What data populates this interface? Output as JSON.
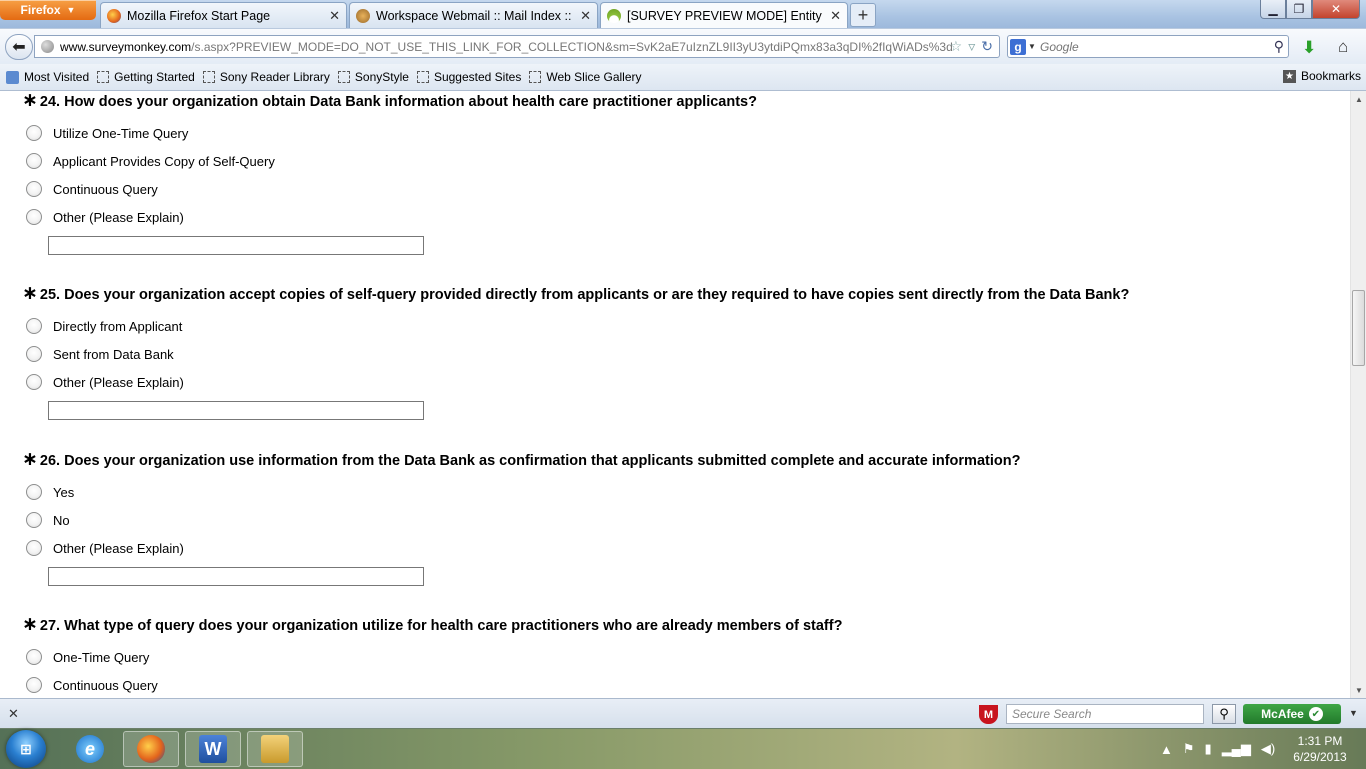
{
  "browser": {
    "menu_label": "Firefox",
    "tabs": [
      {
        "label": "Mozilla Firefox Start Page",
        "active": false
      },
      {
        "label": "Workspace Webmail :: Mail Index :: H...",
        "active": false
      },
      {
        "label": "[SURVEY PREVIEW MODE] Entity Surv...",
        "active": true
      }
    ],
    "url_domain": "www.surveymonkey.com",
    "url_path": "/s.aspx?PREVIEW_MODE=DO_NOT_USE_THIS_LINK_FOR_COLLECTION&sm=SvK2aE7uIznZL9II3yU3ytdiPQmx83a3qDI%2fIqWiADs%3d",
    "search_placeholder": "Google",
    "bookmarks": [
      "Most Visited",
      "Getting Started",
      "Sony Reader Library",
      "SonyStyle",
      "Suggested Sites",
      "Web Slice Gallery"
    ],
    "bookmarks_menu_label": "Bookmarks"
  },
  "survey": {
    "questions": [
      {
        "title": "24. How does your organization obtain Data Bank information about health care practitioner applicants?",
        "options": [
          "Utilize One-Time Query",
          "Applicant Provides Copy of Self-Query",
          "Continuous Query",
          "Other (Please Explain)"
        ],
        "has_other_input": true
      },
      {
        "title": "25. Does your organization accept copies of self-query provided directly from applicants or are they required to have copies sent directly from the Data Bank?",
        "options": [
          "Directly from Applicant",
          "Sent from Data Bank",
          "Other (Please Explain)"
        ],
        "has_other_input": true
      },
      {
        "title": "26. Does your organization use information from the Data Bank as confirmation that applicants submitted complete and accurate information?",
        "options": [
          "Yes",
          "No",
          "Other (Please Explain)"
        ],
        "has_other_input": true
      },
      {
        "title": "27. What type of query does your organization utilize for health care practitioners who are already members of staff?",
        "options": [
          "One-Time Query",
          "Continuous Query"
        ],
        "has_other_input": false
      }
    ]
  },
  "addon_bar": {
    "secure_search_placeholder": "Secure Search",
    "mcafee_label": "McAfee"
  },
  "taskbar": {
    "time": "1:31 PM",
    "date": "6/29/2013"
  }
}
